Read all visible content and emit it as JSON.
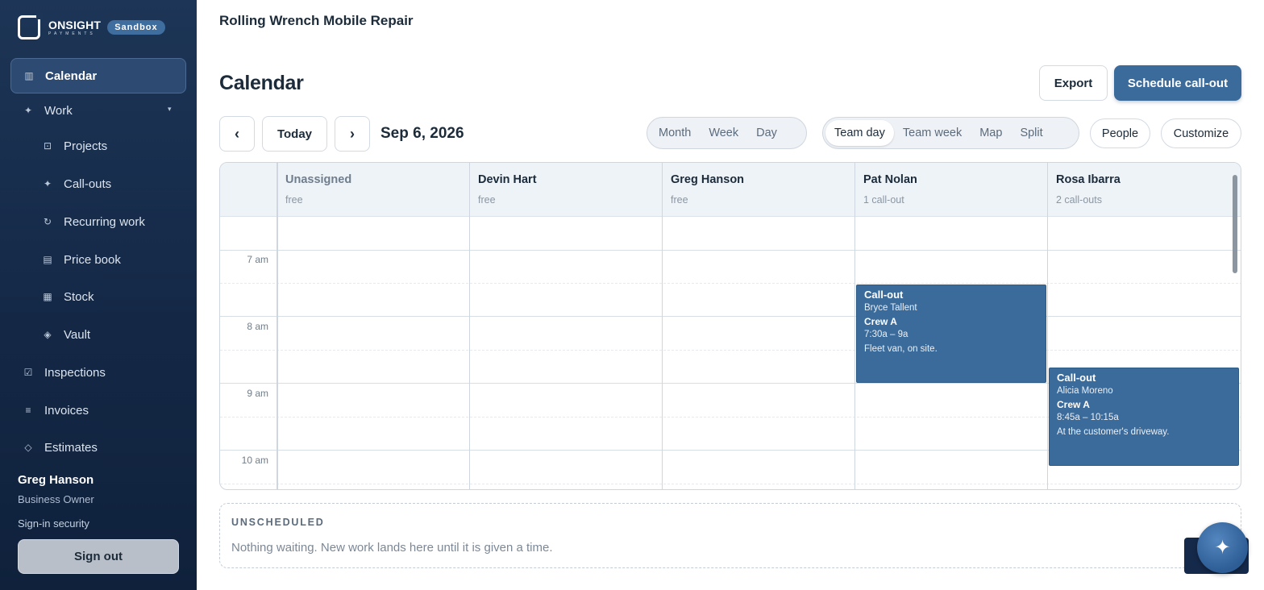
{
  "brand": {
    "name": "ONSIGHT",
    "sub": "PAYMENTS",
    "badge": "Sandbox"
  },
  "sidebar": {
    "items": [
      {
        "label": "Calendar",
        "icon": "calendar-icon"
      },
      {
        "label": "Work",
        "icon": "sparkle-icon"
      },
      {
        "label": "Projects",
        "icon": "projects-icon"
      },
      {
        "label": "Call-outs",
        "icon": "sparkle-icon"
      },
      {
        "label": "Recurring work",
        "icon": "refresh-icon"
      },
      {
        "label": "Price book",
        "icon": "book-icon"
      },
      {
        "label": "Stock",
        "icon": "grid-icon"
      },
      {
        "label": "Vault",
        "icon": "diamond-icon"
      },
      {
        "label": "Inspections",
        "icon": "checkbox-icon"
      },
      {
        "label": "Invoices",
        "icon": "list-icon"
      },
      {
        "label": "Estimates",
        "icon": "diamond-outline-icon"
      }
    ],
    "user": {
      "name": "Greg Hanson",
      "role": "Business Owner"
    },
    "signin_security": "Sign-in security",
    "signout": "Sign out"
  },
  "header": {
    "org": "Rolling Wrench Mobile Repair",
    "title": "Calendar"
  },
  "toolbar": {
    "export": "Export",
    "schedule": "Schedule call-out",
    "prev": "‹",
    "today": "Today",
    "next": "›",
    "date": "Sep 6, 2026",
    "views_a": [
      "Month",
      "Week",
      "Day"
    ],
    "views_b": [
      "Team day",
      "Team week",
      "Map",
      "Split"
    ],
    "active_view": "Team day",
    "people": "People",
    "customize": "Customize"
  },
  "calendar": {
    "columns": [
      {
        "name": "Unassigned",
        "sub": "free"
      },
      {
        "name": "Devin Hart",
        "sub": "free"
      },
      {
        "name": "Greg Hanson",
        "sub": "free"
      },
      {
        "name": "Pat Nolan",
        "sub": "1 call-out"
      },
      {
        "name": "Rosa Ibarra",
        "sub": "2 call-outs"
      }
    ],
    "times": [
      "7 am",
      "8 am",
      "9 am",
      "10 am"
    ],
    "events": [
      {
        "title": "Call-out",
        "customer": "Bryce Tallent",
        "crew": "Crew A",
        "time": "7:30a – 9a",
        "note": "Fleet van, on site."
      },
      {
        "title": "Call-out",
        "customer": "Alicia Moreno",
        "crew": "Crew A",
        "time": "8:45a – 10:15a",
        "note": "At the customer's driveway."
      }
    ]
  },
  "unscheduled": {
    "title": "UNSCHEDULED",
    "text": "Nothing waiting. New work lands here until it is given a time."
  },
  "colors": {
    "accent": "#3b6b9b",
    "sidebar": "#142846"
  }
}
